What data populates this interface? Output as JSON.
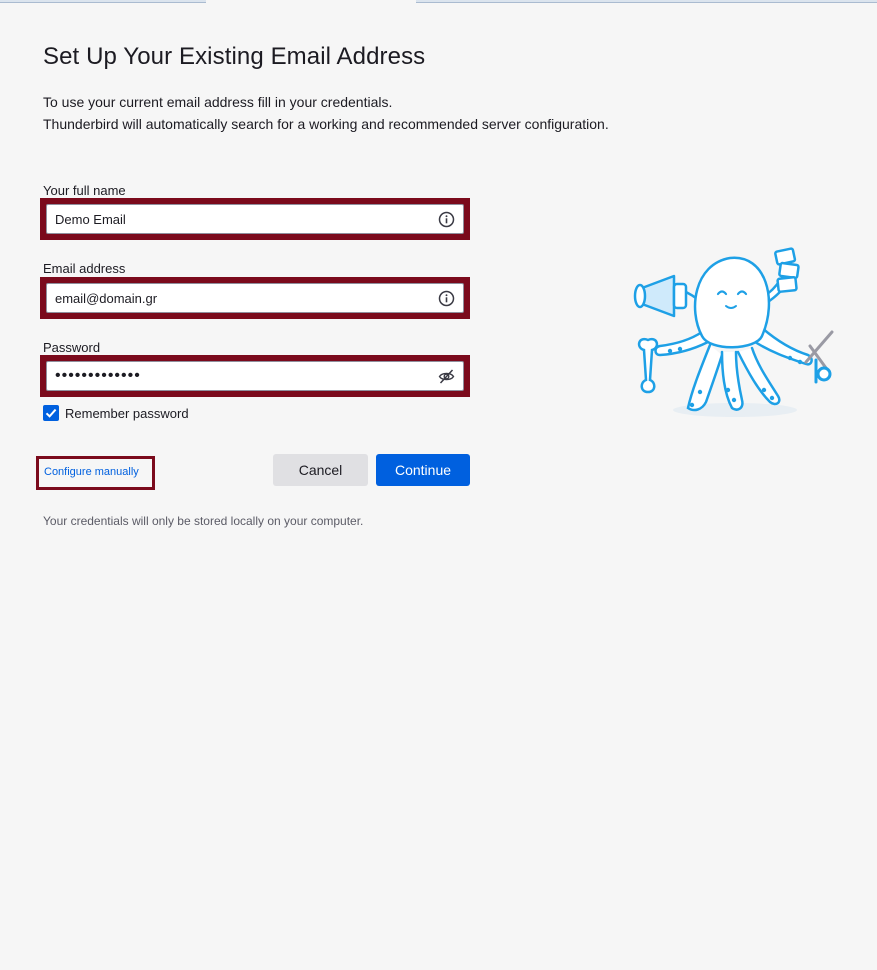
{
  "page": {
    "title": "Set Up Your Existing Email Address",
    "description_line1": "To use your current email address fill in your credentials.",
    "description_line2": "Thunderbird will automatically search for a working and recommended server configuration."
  },
  "form": {
    "fullname": {
      "label": "Your full name",
      "value": "Demo Email",
      "icon": "info-icon"
    },
    "email": {
      "label": "Email address",
      "value": "email@domain.gr",
      "icon": "info-icon"
    },
    "password": {
      "label": "Password",
      "value": "•••••••••••••",
      "icon": "eye-slash-icon"
    },
    "remember": {
      "label": "Remember password",
      "checked": true
    }
  },
  "actions": {
    "configure_manually": "Configure manually",
    "cancel": "Cancel",
    "continue": "Continue"
  },
  "footnote": "Your credentials will only be stored locally on your computer.",
  "colors": {
    "accent": "#0060df",
    "highlight_frame": "#7b0a1c",
    "mascot": "#1ea0e6"
  }
}
